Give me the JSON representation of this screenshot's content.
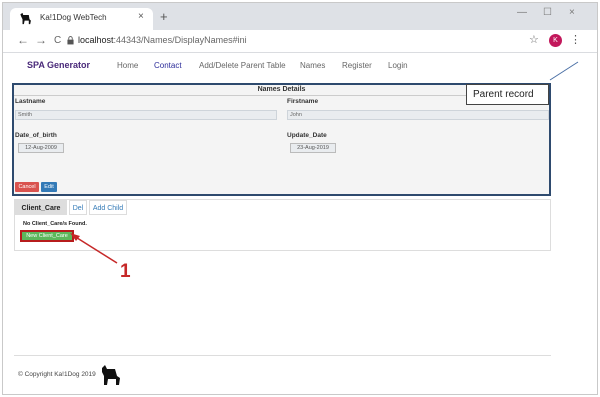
{
  "browser": {
    "tab_title": "Ka!1Dog WebTech",
    "tab_close": "×",
    "new_tab": "+",
    "window_minimize": "—",
    "window_maximize": "☐",
    "window_close": "×",
    "back": "←",
    "forward": "→",
    "reload": "C",
    "url_host": "localhost",
    "url_rest": ":44343/Names/DisplayNames#ini",
    "bookmark": "☆",
    "profile_initial": "K",
    "menu": "⋮"
  },
  "navbar": {
    "brand": "SPA Generator",
    "links": [
      "Home",
      "Contact",
      "Add/Delete Parent Table",
      "Names",
      "Register",
      "Login"
    ]
  },
  "parent_panel": {
    "title": "Names Details",
    "fields": {
      "lastname": {
        "label": "Lastname",
        "value": "Smith"
      },
      "firstname": {
        "label": "Firstname",
        "value": "John"
      },
      "date_of_birth": {
        "label": "Date_of_birth",
        "value": "12-Aug-2009"
      },
      "update_date": {
        "label": "Update_Date",
        "value": "23-Aug-2019"
      }
    },
    "cancel_label": "Cancel",
    "edit_label": "Edit"
  },
  "callout": {
    "text": "Parent record"
  },
  "child_section": {
    "tabs": [
      "Client_Care",
      "Del",
      "Add Child"
    ],
    "empty_message": "No Client_Care/s Found.",
    "new_button": "New Client_Care"
  },
  "annotation": {
    "number": "1"
  },
  "footer": {
    "copyright": "© Copyright Ka!1Dog 2019"
  },
  "colors": {
    "brand": "#4a2a7a",
    "panel_border": "#2e4a6e",
    "cancel": "#d9534f",
    "edit": "#337ab7",
    "new_button": "#5cb85c",
    "annotation": "#c62828"
  },
  "icons": {
    "favicon": "dog-icon",
    "lock": "lock-icon",
    "footer_logo": "dog-icon"
  }
}
